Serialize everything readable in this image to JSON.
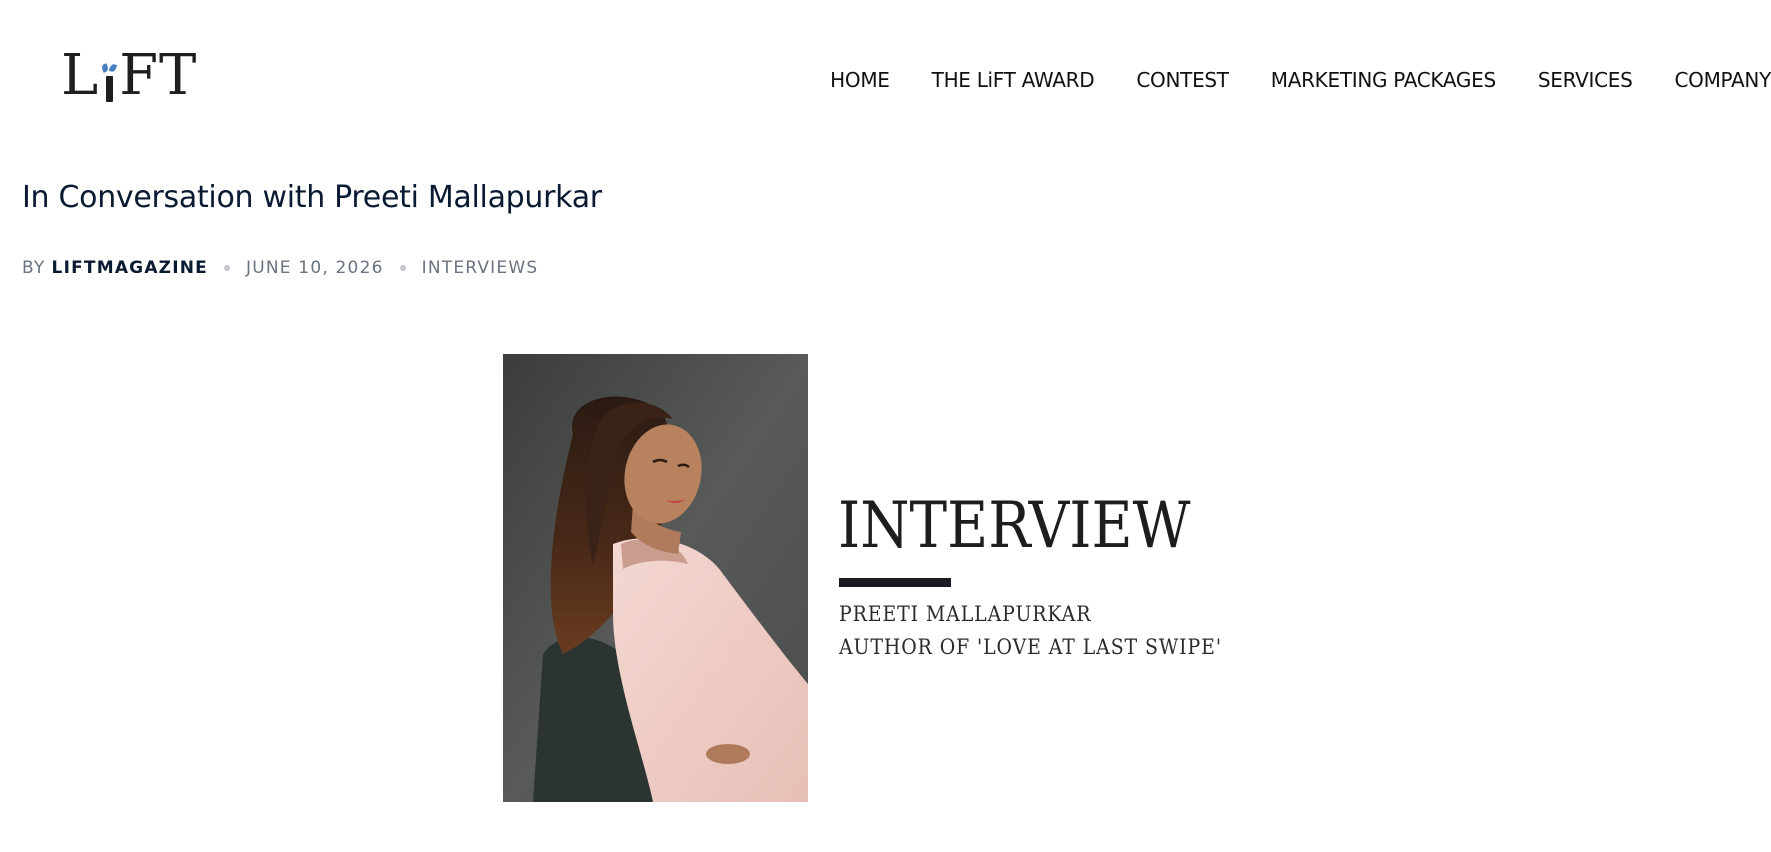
{
  "header": {
    "logo": {
      "text_before": "L",
      "text_after": "FT",
      "accent_color": "#4a7fc1"
    },
    "nav": [
      {
        "label": "HOME"
      },
      {
        "label": "THE LiFT AWARD"
      },
      {
        "label": "CONTEST"
      },
      {
        "label": "MARKETING PACKAGES"
      },
      {
        "label": "SERVICES"
      },
      {
        "label": "COMPANY"
      }
    ]
  },
  "article": {
    "title": "In Conversation with Preeti Mallapurkar",
    "meta": {
      "by_label": "BY",
      "author": "LIFTMAGAZINE",
      "date": "JUNE 10, 2026",
      "category": "INTERVIEWS"
    },
    "featured_image": {
      "heading": "INTERVIEW",
      "line1": "PREETI MALLAPURKAR",
      "line2": "AUTHOR OF 'LOVE AT LAST SWIPE'"
    }
  },
  "colors": {
    "title": "#0b1a33",
    "meta_muted": "#6b7380",
    "separator_dot": "#c4c8ce",
    "photo_background": "#555856",
    "jacket": "#f0cfc8"
  }
}
